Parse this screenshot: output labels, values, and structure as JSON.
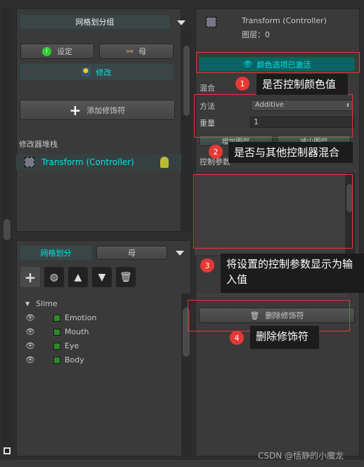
{
  "left_top": {
    "group_label": "网格划分组",
    "setup_label": "设定",
    "bone_label": "母",
    "modify_label": "修改",
    "add_modifier_label": "添加修饰符",
    "stack_label": "修改器堆栈",
    "stack_item": "Transform (Controller)"
  },
  "left_bottom": {
    "mesh_tab": "网格划分",
    "bone_tab": "母",
    "tree_root": "Slime",
    "items": [
      "Emotion",
      "Mouth",
      "Eye",
      "Body"
    ]
  },
  "right": {
    "title": "Transform (Controller)",
    "layer_text": "图层：0",
    "color_button": "颜色选项已激活",
    "blend_label": "混合",
    "method_label": "方法",
    "method_value": "Additive",
    "weight_label": "重量",
    "weight_value": "1",
    "add_layer": "增加图层",
    "remove_layer": "减少图层",
    "control_params_label": "控制参数",
    "delete_modifier": "删除修饰符"
  },
  "callouts": [
    {
      "num": "1",
      "text": "是否控制颜色值"
    },
    {
      "num": "2",
      "text": "是否与其他控制器混合"
    },
    {
      "num": "3",
      "text": "将设置的控制参数显示为输入值"
    },
    {
      "num": "4",
      "text": "删除修饰符"
    }
  ],
  "watermark": "CSDN @恬静的小魔龙",
  "colors": {
    "accent": "#00e5e5",
    "callout_red": "#e53935"
  }
}
